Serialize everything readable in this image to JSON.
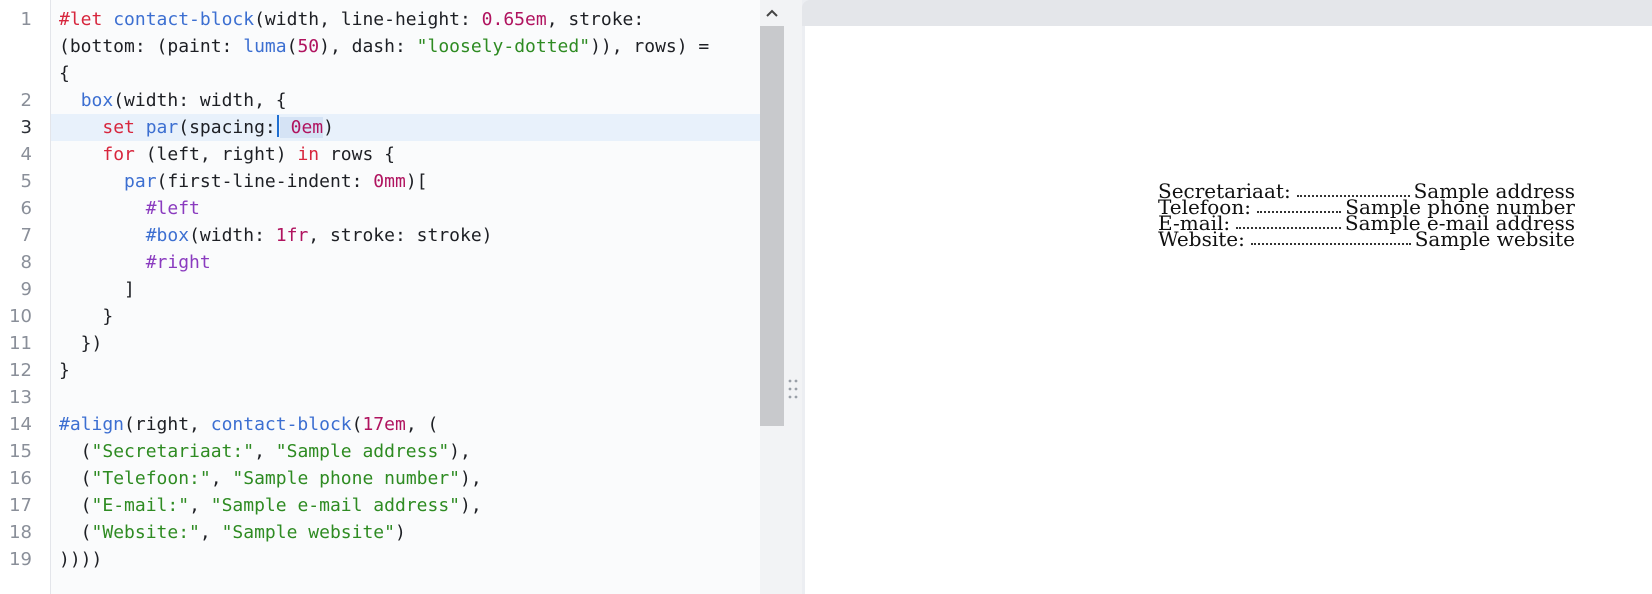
{
  "editor": {
    "line_numbers": [
      "1",
      "2",
      "3",
      "4",
      "5",
      "6",
      "7",
      "8",
      "9",
      "10",
      "11",
      "12",
      "13",
      "14",
      "15",
      "16",
      "17",
      "18",
      "19"
    ],
    "current_line": "3",
    "code_lines": [
      [
        "#let",
        " ",
        "contact-block",
        "(width, line-height: ",
        "0.65em",
        ", stroke:"
      ],
      [
        "(bottom: (paint: ",
        "luma",
        "(",
        "50",
        "), dash: ",
        "\"loosely-dotted\"",
        ")), rows) ="
      ],
      [
        "{"
      ],
      [
        "  ",
        "box",
        "(width: width, {"
      ],
      [
        "    ",
        "set",
        " ",
        "par",
        "(spacing:",
        "",
        " ",
        "0em",
        ")"
      ],
      [
        "    ",
        "for",
        " (left, right) ",
        "in",
        " rows {"
      ],
      [
        "      ",
        "par",
        "(first-line-indent: ",
        "0mm",
        ")["
      ],
      [
        "        ",
        "#left"
      ],
      [
        "        ",
        "#box",
        "(width: ",
        "1fr",
        ", stroke: stroke)"
      ],
      [
        "        ",
        "#right"
      ],
      [
        "      ]"
      ],
      [
        "    }"
      ],
      [
        "  })"
      ],
      [
        "}"
      ],
      [
        ""
      ],
      [
        "#align",
        "(right, ",
        "contact-block",
        "(",
        "17em",
        ", ("
      ],
      [
        "  (",
        "\"Secretariaat:\"",
        ", ",
        "\"Sample address\"",
        "),"
      ],
      [
        "  (",
        "\"Telefoon:\"",
        ", ",
        "\"Sample phone number\"",
        "),"
      ],
      [
        "  (",
        "\"E-mail:\"",
        ", ",
        "\"Sample e-mail address\"",
        "),"
      ],
      [
        "  (",
        "\"Website:\"",
        ", ",
        "\"Sample website\"",
        ")"
      ],
      [
        "))))"
      ]
    ]
  },
  "colors": {
    "keyword": "#d7263d",
    "function": "#3c6fd1",
    "number": "#b0135f",
    "string": "#2e8b22",
    "variable": "#8a3bbf"
  },
  "preview": {
    "contacts": [
      {
        "label": "Secretariaat:",
        "value": "Sample address"
      },
      {
        "label": "Telefoon:",
        "value": "Sample phone number"
      },
      {
        "label": "E-mail:",
        "value": "Sample e-mail address"
      },
      {
        "label": "Website:",
        "value": "Sample website"
      }
    ]
  },
  "icons": {
    "scroll_up": "chevron-up-icon",
    "divider": "drag-grip-icon"
  }
}
